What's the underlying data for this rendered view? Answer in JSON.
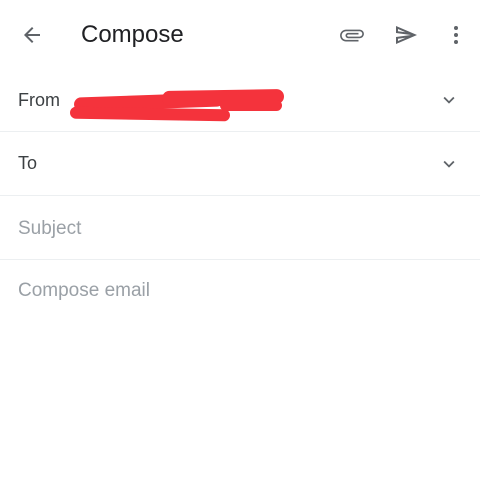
{
  "header": {
    "title": "Compose",
    "back_icon": "arrow-back-icon",
    "attach_icon": "paperclip-icon",
    "send_icon": "send-icon",
    "more_icon": "more-vert-icon"
  },
  "fields": {
    "from_label": "From",
    "from_value": "",
    "to_label": "To",
    "subject_placeholder": "Subject",
    "body_placeholder": "Compose email"
  },
  "colors": {
    "redaction": "#f4333c",
    "icon": "#5f6368",
    "placeholder": "#9aa0a6",
    "divider": "#eceff1"
  }
}
